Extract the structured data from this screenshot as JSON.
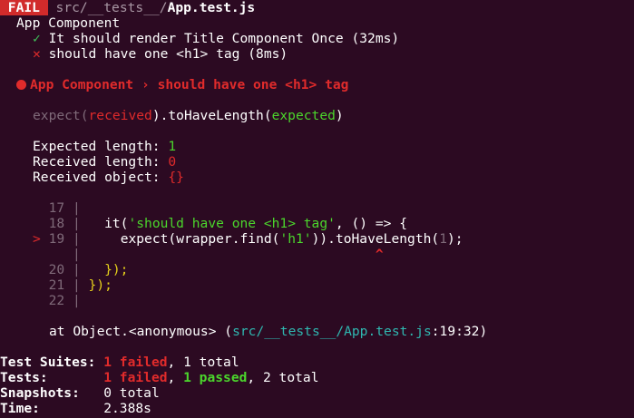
{
  "header": {
    "badge": "FAIL",
    "path_dir": "src/__tests__/",
    "path_file": "App.test.js"
  },
  "suite": {
    "name": "App Component",
    "tests": [
      {
        "status_glyph": "✓",
        "text": "It should render Title Component Once (32ms)"
      },
      {
        "status_glyph": "✕",
        "text": "should have one <h1> tag (8ms)"
      }
    ]
  },
  "failure": {
    "title": "App Component › should have one <h1> tag",
    "expect_prefix": "expect(",
    "expect_received": "received",
    "expect_middle": ").toHaveLength(",
    "expect_expected": "expected",
    "expect_suffix": ")",
    "expected_label": "Expected length: ",
    "expected_value": "1",
    "received_label": "Received length: ",
    "received_value": "0",
    "object_label": "Received object: ",
    "object_value": "{}"
  },
  "code": {
    "lines": [
      {
        "marker": "",
        "num": "17",
        "text": ""
      },
      {
        "marker": "",
        "num": "18",
        "text": "  it('should have one <h1> tag', () => {"
      },
      {
        "marker": ">",
        "num": "19",
        "text": "    expect(wrapper.find('h1')).toHaveLength(1);"
      },
      {
        "marker": "",
        "num": "",
        "text": "                                 ^"
      },
      {
        "marker": "",
        "num": "20",
        "text": "  });"
      },
      {
        "marker": "",
        "num": "21",
        "text": "});"
      },
      {
        "marker": "",
        "num": "22",
        "text": ""
      }
    ],
    "l18_it": "it(",
    "l18_str": "'should have one <h1> tag'",
    "l18_rest": ", () => {",
    "l19_a": "expect(wrapper.find(",
    "l19_str": "'h1'",
    "l19_b": ")).",
    "l19_method": "toHaveLength",
    "l19_c": "(",
    "l19_num": "1",
    "l19_d": ");",
    "caret": "^",
    "l20_a": "});",
    "l21_a": "});"
  },
  "stack": {
    "prefix": "at Object.<anonymous> (",
    "path": "src/__tests__/App.test.js",
    "suffix": ":19:32)"
  },
  "summary": {
    "suites_label": "Test Suites: ",
    "suites_failed": "1 failed",
    "suites_total": ", 1 total",
    "tests_label": "Tests:       ",
    "tests_failed": "1 failed",
    "tests_sep": ", ",
    "tests_passed": "1 passed",
    "tests_total": ", 2 total",
    "snapshots_label": "Snapshots:   ",
    "snapshots_value": "0 total",
    "time_label": "Time:        ",
    "time_value": "2.388s"
  },
  "colors": {
    "background": "#2c0a22",
    "fail_badge": "#d12b2b",
    "red": "#e02b2b",
    "green": "#4bd62c",
    "cyan": "#2fb7b0",
    "yellow": "#e6d11b"
  }
}
